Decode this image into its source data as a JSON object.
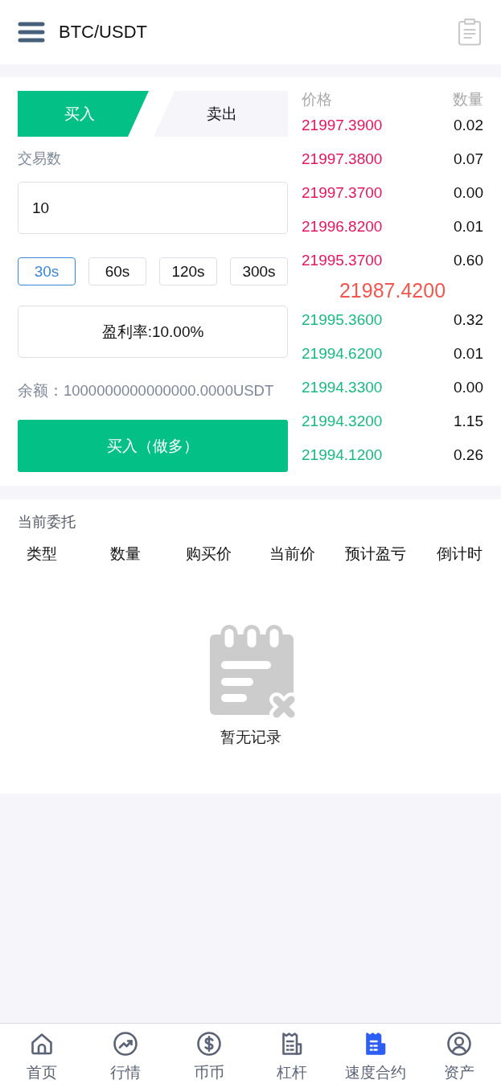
{
  "header": {
    "title": "BTC/USDT"
  },
  "trade": {
    "tabs": [
      {
        "label": "买入",
        "selected": true
      },
      {
        "label": "卖出",
        "selected": false
      }
    ],
    "amount_label": "交易数",
    "amount_input": {
      "value": "10"
    },
    "durations": [
      {
        "label": "30s",
        "selected": true
      },
      {
        "label": "60s",
        "selected": false
      },
      {
        "label": "120s",
        "selected": false
      },
      {
        "label": "300s",
        "selected": false
      }
    ],
    "profit_rate": "盈利率:10.00%",
    "balance": "余额：1000000000000000.0000USDT",
    "submit_button": "买入（做多）"
  },
  "order_book": {
    "columns": [
      "价格",
      "数量"
    ],
    "asks": [
      {
        "price": "21997.3900",
        "amount": "0.02"
      },
      {
        "price": "21997.3800",
        "amount": "0.07"
      },
      {
        "price": "21997.3700",
        "amount": "0.00"
      },
      {
        "price": "21996.8200",
        "amount": "0.01"
      },
      {
        "price": "21995.3700",
        "amount": "0.60"
      }
    ],
    "last_price": "21987.4200",
    "bids": [
      {
        "price": "21995.3600",
        "amount": "0.32"
      },
      {
        "price": "21994.6200",
        "amount": "0.01"
      },
      {
        "price": "21994.3300",
        "amount": "0.00"
      },
      {
        "price": "21994.3200",
        "amount": "1.15"
      },
      {
        "price": "21994.1200",
        "amount": "0.26"
      }
    ]
  },
  "current_orders": {
    "title": "当前委托",
    "columns": [
      "类型",
      "数量",
      "购买价",
      "当前价",
      "预计盈亏",
      "倒计时"
    ],
    "empty_text": "暂无记录"
  },
  "bottom_nav": [
    {
      "label": "首页",
      "selected": false
    },
    {
      "label": "行情",
      "selected": false
    },
    {
      "label": "币币",
      "selected": false
    },
    {
      "label": "杠杆",
      "selected": false
    },
    {
      "label": "速度合约",
      "selected": true
    },
    {
      "label": "资产",
      "selected": false
    }
  ]
}
